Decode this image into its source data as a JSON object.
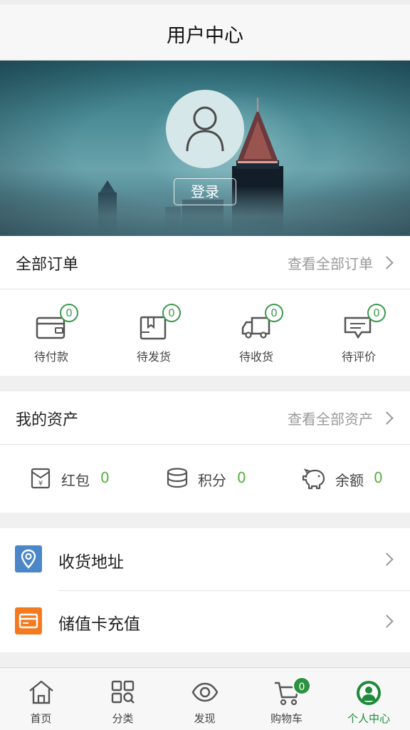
{
  "header": {
    "title": "用户中心"
  },
  "profile": {
    "login_label": "登录"
  },
  "orders": {
    "title": "全部订单",
    "view_all": "查看全部订单",
    "items": [
      {
        "label": "待付款",
        "count": "0",
        "icon": "wallet-icon"
      },
      {
        "label": "待发货",
        "count": "0",
        "icon": "package-icon"
      },
      {
        "label": "待收货",
        "count": "0",
        "icon": "truck-icon"
      },
      {
        "label": "待评价",
        "count": "0",
        "icon": "comment-icon"
      }
    ]
  },
  "assets": {
    "title": "我的资产",
    "view_all": "查看全部资产",
    "items": [
      {
        "label": "红包",
        "value": "0",
        "icon": "red-packet-icon"
      },
      {
        "label": "积分",
        "value": "0",
        "icon": "coins-icon"
      },
      {
        "label": "余额",
        "value": "0",
        "icon": "piggy-bank-icon"
      }
    ]
  },
  "links": [
    {
      "label": "收货地址",
      "icon": "location-pin-icon",
      "color": "#4a86c8"
    },
    {
      "label": "储值卡充值",
      "icon": "card-icon",
      "color": "#f47a1f"
    }
  ],
  "tabbar": {
    "items": [
      {
        "label": "首页",
        "icon": "home-icon"
      },
      {
        "label": "分类",
        "icon": "category-grid-icon"
      },
      {
        "label": "发现",
        "icon": "eye-icon"
      },
      {
        "label": "购物车",
        "icon": "cart-icon",
        "badge": "0"
      },
      {
        "label": "个人中心",
        "icon": "user-circle-icon",
        "active": true
      }
    ]
  },
  "colors": {
    "accent": "#56ae3f",
    "active_tab": "#1e8a3a",
    "badge_green": "#3b9a4d"
  }
}
